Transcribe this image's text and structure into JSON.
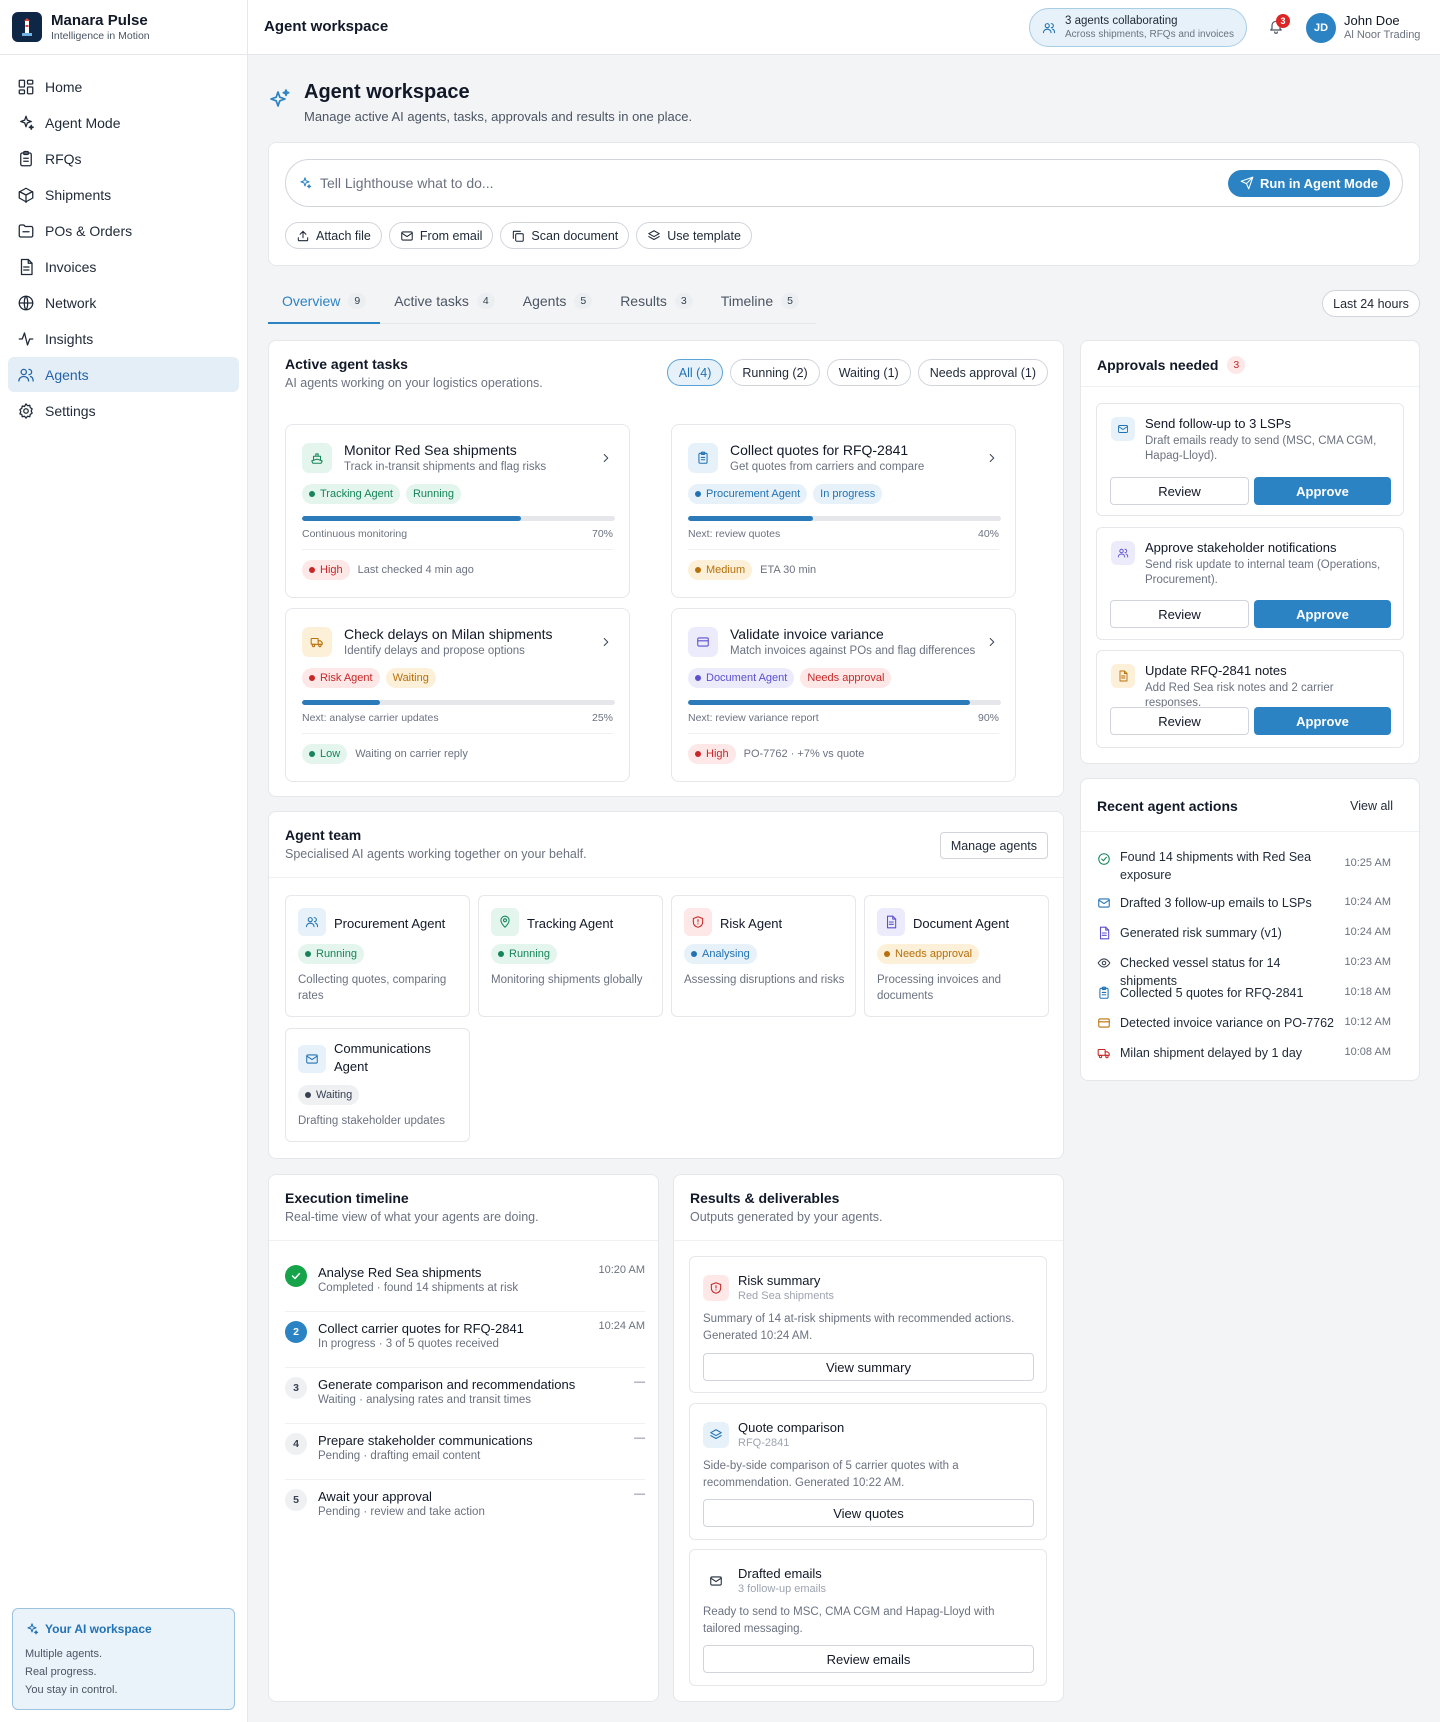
{
  "brand": {
    "name": "Manara Pulse",
    "tagline": "Intelligence in Motion"
  },
  "nav": [
    {
      "label": "Home",
      "icon": "grid-icon"
    },
    {
      "label": "Agent Mode",
      "icon": "sparkle-icon"
    },
    {
      "label": "RFQs",
      "icon": "clipboard-icon"
    },
    {
      "label": "Shipments",
      "icon": "box-icon"
    },
    {
      "label": "POs & Orders",
      "icon": "folder-icon"
    },
    {
      "label": "Invoices",
      "icon": "document-icon"
    },
    {
      "label": "Network",
      "icon": "globe-icon"
    },
    {
      "label": "Insights",
      "icon": "activity-icon"
    },
    {
      "label": "Agents",
      "icon": "users-icon",
      "active": true
    },
    {
      "label": "Settings",
      "icon": "gear-icon"
    }
  ],
  "ai_box": {
    "title": "Your AI workspace",
    "lines": [
      "Multiple agents.",
      "Real progress.",
      "You stay in control."
    ]
  },
  "header": {
    "title": "Agent workspace",
    "collab_title": "3 agents collaborating",
    "collab_sub": "Across shipments, RFQs and invoices",
    "notif_count": "3",
    "user_initials": "JD",
    "user_name": "John Doe",
    "user_org": "Al Noor Trading"
  },
  "page": {
    "title": "Agent workspace",
    "subtitle": "Manage active AI agents, tasks, approvals and results in one place."
  },
  "command": {
    "placeholder": "Tell Lighthouse what to do...",
    "run_label": "Run in Agent Mode",
    "chips": [
      "Attach file",
      "From email",
      "Scan document",
      "Use template"
    ]
  },
  "tabs": [
    {
      "label": "Overview",
      "count": "9"
    },
    {
      "label": "Active tasks",
      "count": "4"
    },
    {
      "label": "Agents",
      "count": "5"
    },
    {
      "label": "Results",
      "count": "3"
    },
    {
      "label": "Timeline",
      "count": "5"
    }
  ],
  "time_filter": "Last 24 hours",
  "tasks": {
    "title": "Active agent tasks",
    "subtitle": "AI agents working on your logistics operations.",
    "filters": [
      "All (4)",
      "Running (2)",
      "Waiting (1)",
      "Needs approval (1)"
    ],
    "items": [
      {
        "title": "Monitor Red Sea shipments",
        "sub": "Track in-transit shipments and flag risks",
        "agent": "Tracking Agent",
        "status": "Running",
        "progress": 0.7,
        "next": "Continuous monitoring",
        "pct": "70%",
        "priority": "High",
        "meta": "Last checked 4 min ago"
      },
      {
        "title": "Collect quotes for RFQ-2841",
        "sub": "Get quotes from carriers and compare",
        "agent": "Procurement Agent",
        "status": "In progress",
        "progress": 0.4,
        "next": "Next: review quotes",
        "pct": "40%",
        "priority": "Medium",
        "meta": "ETA 30 min"
      },
      {
        "title": "Check delays on Milan shipments",
        "sub": "Identify delays and propose options",
        "agent": "Risk Agent",
        "status": "Waiting",
        "progress": 0.25,
        "next": "Next: analyse carrier updates",
        "pct": "25%",
        "priority": "Low",
        "meta": "Waiting on carrier reply"
      },
      {
        "title": "Validate invoice variance",
        "sub": "Match invoices against POs and flag differences",
        "agent": "Document Agent",
        "status": "Needs approval",
        "progress": 0.9,
        "next": "Next: review variance report",
        "pct": "90%",
        "priority": "High",
        "meta": "PO-7762 · +7% vs quote"
      }
    ]
  },
  "team": {
    "title": "Agent team",
    "subtitle": "Specialised AI agents working together on your behalf.",
    "manage_label": "Manage agents",
    "agents": [
      {
        "name": "Procurement Agent",
        "status": "Running",
        "desc": "Collecting quotes, comparing rates"
      },
      {
        "name": "Tracking Agent",
        "status": "Running",
        "desc": "Monitoring shipments globally"
      },
      {
        "name": "Risk Agent",
        "status": "Analysing",
        "desc": "Assessing disruptions and risks"
      },
      {
        "name": "Document Agent",
        "status": "Needs approval",
        "desc": "Processing invoices and documents"
      },
      {
        "name": "Communications Agent",
        "status": "Waiting",
        "desc": "Drafting stakeholder updates"
      }
    ]
  },
  "approvals": {
    "title": "Approvals needed",
    "count": "3",
    "review_label": "Review",
    "approve_label": "Approve",
    "items": [
      {
        "title": "Send follow-up to 3 LSPs",
        "desc": "Draft emails ready to send (MSC, CMA CGM, Hapag-Lloyd)."
      },
      {
        "title": "Approve stakeholder notifications",
        "desc": "Send risk update to internal team (Operations, Procurement)."
      },
      {
        "title": "Update RFQ-2841 notes",
        "desc": "Add Red Sea risk notes and 2 carrier responses."
      }
    ]
  },
  "recent": {
    "title": "Recent agent actions",
    "view_all": "View all",
    "items": [
      {
        "text": "Found 14 shipments with Red Sea exposure",
        "time": "10:25 AM",
        "icon": "check-circle-icon"
      },
      {
        "text": "Drafted 3 follow-up emails to LSPs",
        "time": "10:24 AM",
        "icon": "mail-icon"
      },
      {
        "text": "Generated risk summary (v1)",
        "time": "10:24 AM",
        "icon": "document-icon"
      },
      {
        "text": "Checked vessel status for 14 shipments",
        "time": "10:23 AM",
        "icon": "eye-icon"
      },
      {
        "text": "Collected 5 quotes for RFQ-2841",
        "time": "10:18 AM",
        "icon": "clipboard-icon"
      },
      {
        "text": "Detected invoice variance on PO-7762",
        "time": "10:12 AM",
        "icon": "card-icon"
      },
      {
        "text": "Milan shipment delayed by 1 day",
        "time": "10:08 AM",
        "icon": "truck-icon"
      }
    ]
  },
  "timeline": {
    "title": "Execution timeline",
    "subtitle": "Real-time view of what your agents are doing.",
    "items": [
      {
        "num": "",
        "title": "Analyse Red Sea shipments",
        "sub": "Completed · found 14 shipments at risk",
        "time": "10:20 AM",
        "state": "done"
      },
      {
        "num": "2",
        "title": "Collect carrier quotes for RFQ-2841",
        "sub": "In progress · 3 of 5 quotes received",
        "time": "10:24 AM",
        "state": "active"
      },
      {
        "num": "3",
        "title": "Generate comparison and recommendations",
        "sub": "Waiting · analysing rates and transit times",
        "time": "—",
        "state": "pending"
      },
      {
        "num": "4",
        "title": "Prepare stakeholder communications",
        "sub": "Pending · drafting email content",
        "time": "—",
        "state": "pending"
      },
      {
        "num": "5",
        "title": "Await your approval",
        "sub": "Pending · review and take action",
        "time": "—",
        "state": "pending"
      }
    ]
  },
  "results": {
    "title": "Results & deliverables",
    "subtitle": "Outputs generated by your agents.",
    "items": [
      {
        "title": "Risk summary",
        "sub": "Red Sea shipments",
        "desc": "Summary of 14 at-risk shipments with recommended actions. Generated 10:24 AM.",
        "button": "View summary"
      },
      {
        "title": "Quote comparison",
        "sub": "RFQ-2841",
        "desc": "Side-by-side comparison of 5 carrier quotes with a recommendation. Generated 10:22 AM.",
        "button": "View quotes"
      },
      {
        "title": "Drafted emails",
        "sub": "3 follow-up emails",
        "desc": "Ready to send to MSC, CMA CGM and Hapag-Lloyd with tailored messaging.",
        "button": "Review emails"
      }
    ]
  }
}
